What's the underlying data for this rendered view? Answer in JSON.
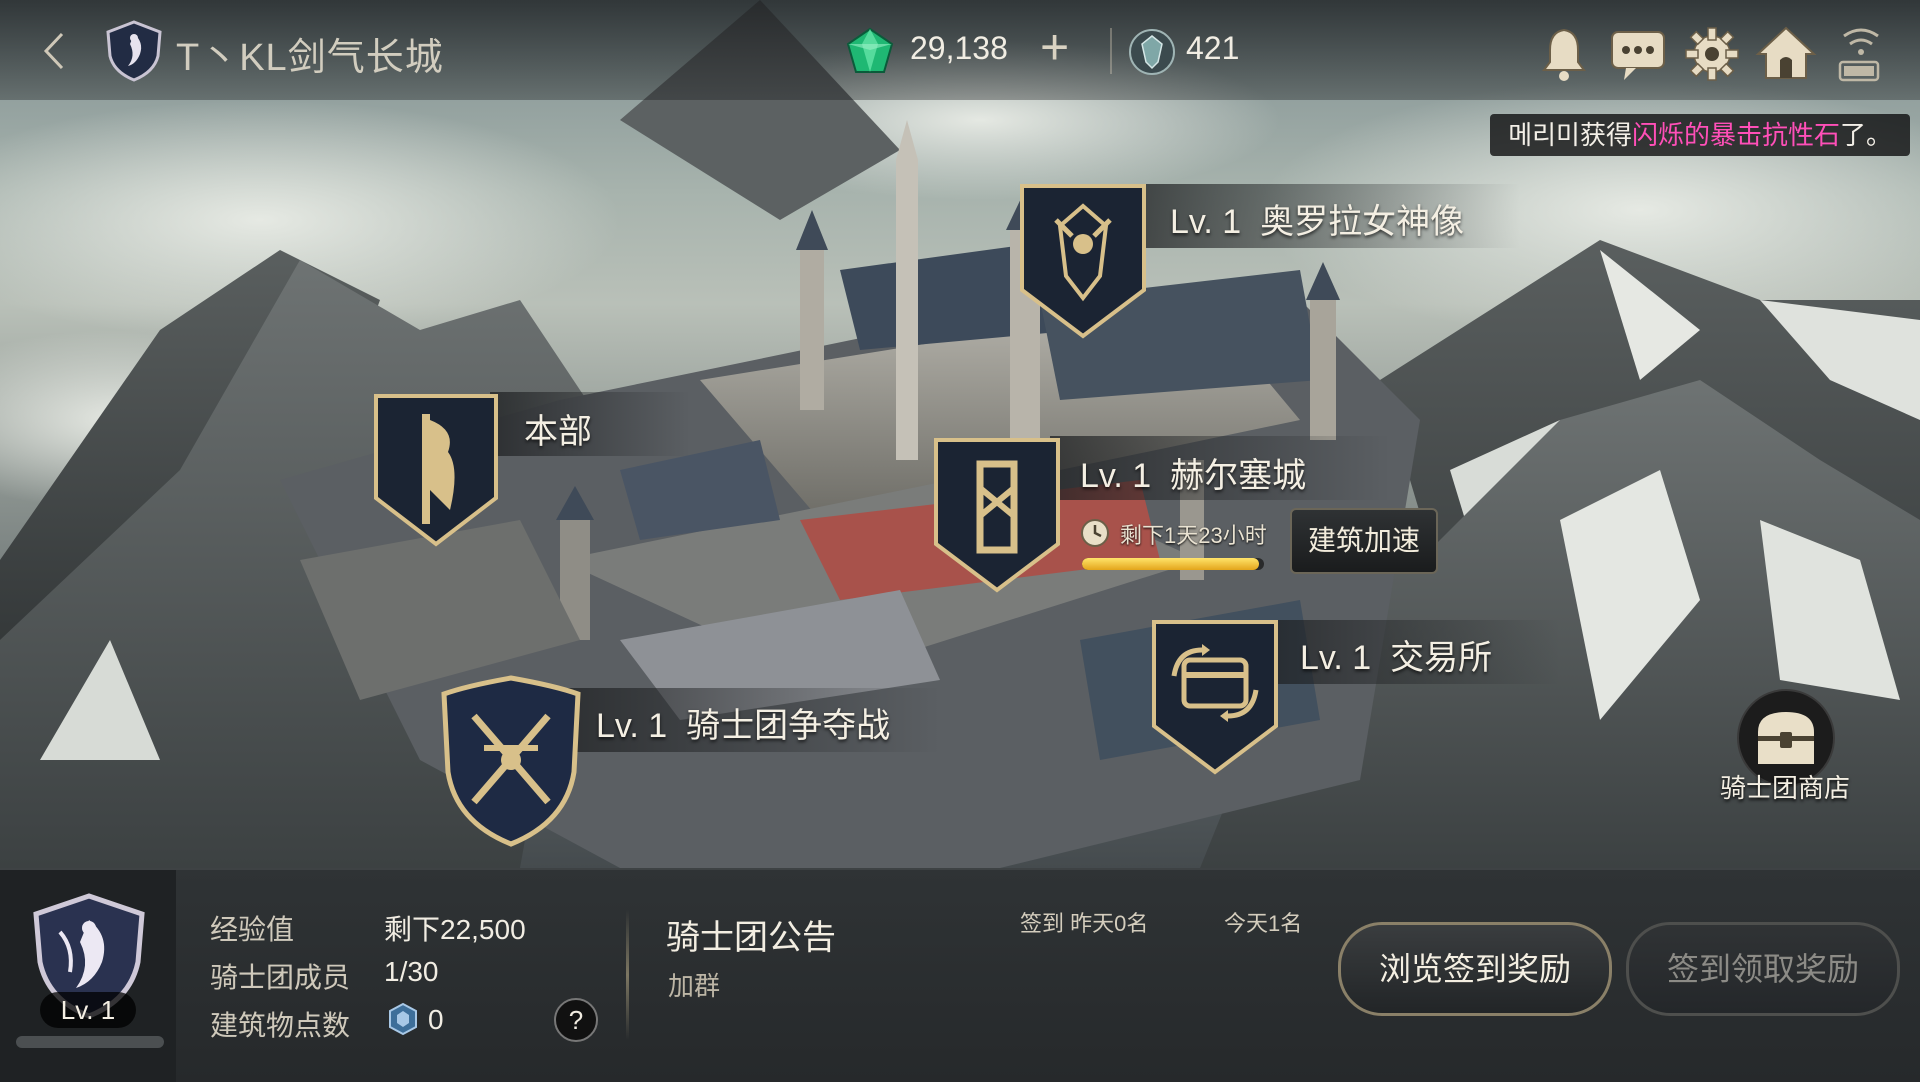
{
  "header": {
    "back_icon": "chevron-left-icon",
    "guild_name": "T丶KL剑气长城",
    "gems": "29,138",
    "add_symbol": "+",
    "crest_points": "421"
  },
  "notification": {
    "name": "메리미",
    "action": "获得",
    "item": "闪烁的暴击抗性石",
    "suffix": "了。",
    "highlight_color": "#ff4fb8"
  },
  "buildings": {
    "statue": {
      "level": "Lv. 1",
      "name": "奥罗拉女神像"
    },
    "hq": {
      "name": "本部"
    },
    "castle": {
      "level": "Lv. 1",
      "name": "赫尔塞城",
      "timer": "剩下1天23小时",
      "progress": 0.97,
      "speed_button": "建筑加速"
    },
    "exchange": {
      "level": "Lv. 1",
      "name": "交易所"
    },
    "war": {
      "level": "Lv. 1",
      "name": "骑士团争夺战"
    }
  },
  "shop": {
    "label": "骑士团商店"
  },
  "panel": {
    "guild_level": "Lv. 1",
    "exp_label": "经验值",
    "exp_value": "剩下22,500",
    "members_label": "骑士团成员",
    "members_value": "1/30",
    "points_label": "建筑物点数",
    "points_value": "0",
    "help": "?",
    "notice_title": "骑士团公告",
    "notice_body": "加群",
    "checkin_yesterday": "签到 昨天0名",
    "checkin_today": "今天1名",
    "browse_button": "浏览签到奖励",
    "claim_button": "签到领取奖励"
  },
  "colors": {
    "progress_fill": "#f2c233",
    "accent_gold": "#d8c08a"
  }
}
